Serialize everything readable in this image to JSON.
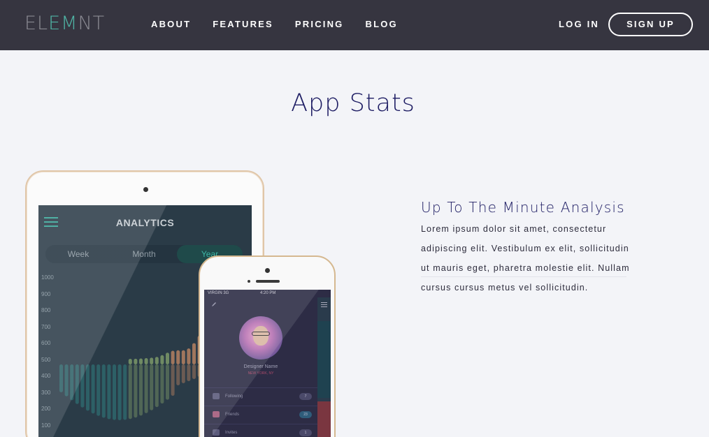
{
  "nav": {
    "logo_parts": [
      "EL",
      "EM",
      "NT"
    ],
    "links": [
      "ABOUT",
      "FEATURES",
      "PRICING",
      "BLOG"
    ],
    "login": "LOG IN",
    "signup": "SIGN UP"
  },
  "section": {
    "title": "App Stats"
  },
  "feature": {
    "title": "Up To The Minute Analysis",
    "text": "Lorem ipsum dolor sit amet, consectetur adipiscing elit. Vestibulum ex elit, sollicitudin ut mauris eget, pharetra molestie elit. Nullam cursus cursus metus vel sollicitudin."
  },
  "tablet": {
    "title": "ANALYTICS",
    "segments": [
      "Week",
      "Month",
      "Year"
    ],
    "active_segment": "Year",
    "y_labels": [
      "1000",
      "900",
      "800",
      "700",
      "600",
      "500",
      "400",
      "300",
      "200",
      "100"
    ]
  },
  "phone": {
    "carrier": "VIRGIN  3G",
    "time": "4:20 PM",
    "name": "Designer Name",
    "subtitle": "NEW YORK, NY",
    "rows": [
      {
        "label": "Following",
        "badge": "7"
      },
      {
        "label": "Friends",
        "badge": "23"
      },
      {
        "label": "Invites",
        "badge": "1"
      }
    ]
  },
  "colors": {
    "nav_bg": "#363540",
    "accent": "#4fb3a4",
    "heading": "#1d1c63",
    "page_bg": "#f3f4f8"
  }
}
